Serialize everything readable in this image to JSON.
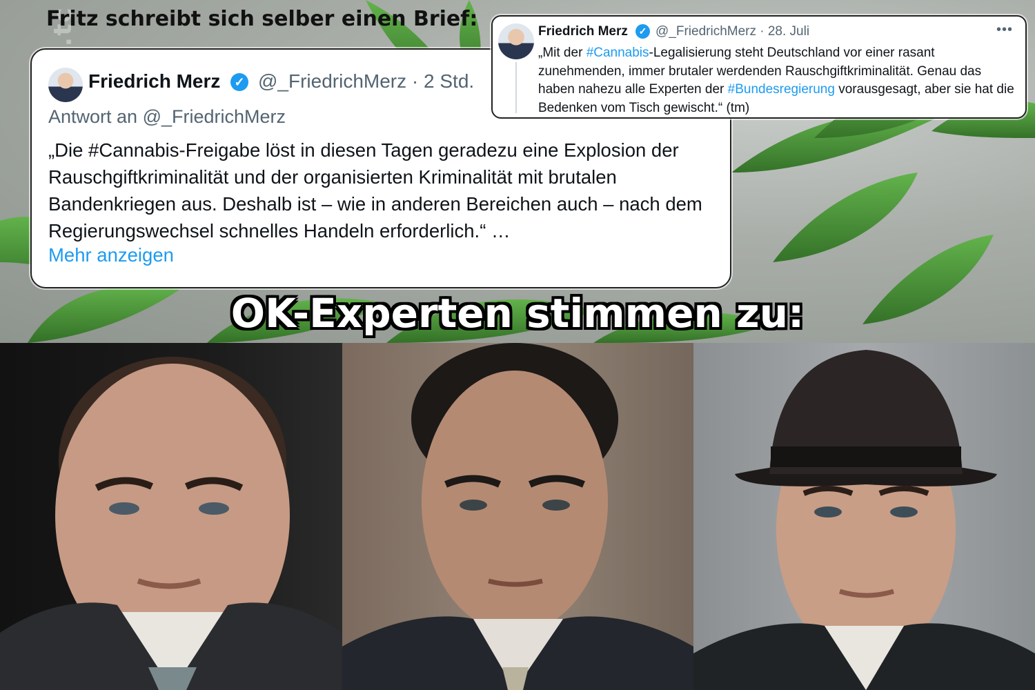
{
  "watermark": "www.420.tc",
  "headline": "Fritz schreibt sich selber einen Brief:",
  "tweet_reply": {
    "name": "Friedrich Merz",
    "handle_time": "@_FriedrichMerz · 2 Std.",
    "reply_to": "Antwort an @_FriedrichMerz",
    "text": "„Die #Cannabis-Freigabe löst in diesen Tagen geradezu eine Explosion der Rauschgiftkriminalität und der organisierten Kriminalität mit brutalen Bandenkriegen aus. Deshalb ist – wie in anderen Bereichen auch – nach dem Regierungswechsel schnelles Handeln erforderlich.“ …",
    "more_label": "Mehr anzeigen"
  },
  "tweet_original": {
    "name": "Friedrich Merz",
    "handle_time": "@_FriedrichMerz · 28. Juli",
    "text_part1": "„Mit der ",
    "hashtag1": "#Cannabis",
    "text_part2": "-Legalisierung steht Deutschland vor einer rasant zunehmenden, immer brutaler werdenden Rauschgiftkriminalität. Genau das haben nahezu alle Experten der ",
    "hashtag2": "#Bundesregierung",
    "text_part3": " vorausgesagt, aber sie hat die Bedenken vom Tisch gewischt.“ (tm)",
    "menu_icon": "more-dots-icon"
  },
  "banner": "OK-Experten stimmen zu:",
  "colors": {
    "link_blue": "#1d9bf0",
    "verified_blue": "#1d9bf0",
    "leaf_green": "#3e8f2e"
  }
}
